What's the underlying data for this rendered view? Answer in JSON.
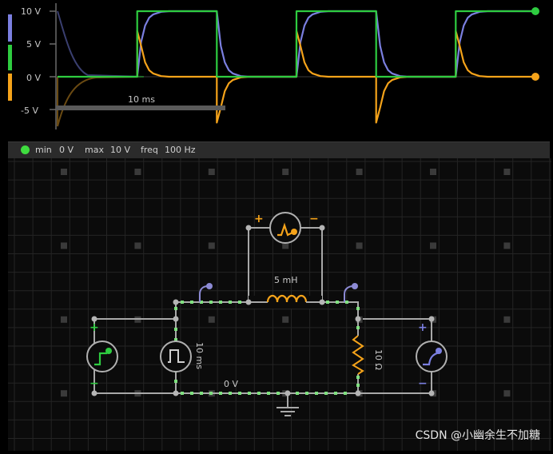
{
  "scope": {
    "y_labels": [
      "10 V",
      "5 V",
      "0 V",
      "-5 V"
    ],
    "time_label": "10 ms",
    "channel_colors": [
      "#7b7fe0",
      "#2ecc40",
      "#f5a31a"
    ],
    "channel_names": [
      "blue-channel",
      "green-channel",
      "orange-channel"
    ]
  },
  "chart_data": {
    "type": "line",
    "ylim": [
      -7.5,
      10
    ],
    "y_ticks": [
      10,
      5,
      0,
      -5
    ],
    "x_range_ms": [
      0,
      60
    ],
    "series": [
      {
        "color": "#2ecc40",
        "x": [
          0,
          10,
          10,
          20,
          20,
          30,
          30,
          40,
          40,
          50,
          50,
          60
        ],
        "y": [
          0,
          0,
          10,
          10,
          0,
          0,
          10,
          10,
          0,
          0,
          10,
          10
        ]
      },
      {
        "color": "#7b7fe0",
        "x": [
          10,
          10.5,
          11,
          11.5,
          12,
          13,
          14,
          15,
          17,
          20,
          20.5,
          21,
          21.5,
          22,
          23,
          24,
          25,
          27,
          30,
          30.5,
          31,
          31.5,
          32,
          33,
          34,
          35,
          37,
          40,
          40.5,
          41,
          41.5,
          42,
          43,
          44,
          45,
          47,
          50,
          50.5,
          51,
          51.5,
          52,
          53,
          54,
          55,
          57,
          60
        ],
        "y": [
          0,
          5.3,
          7.8,
          9.0,
          9.5,
          9.9,
          10,
          10,
          10,
          10,
          4.7,
          2.2,
          1.0,
          0.5,
          0.1,
          0,
          0,
          0,
          0,
          5.3,
          7.8,
          9.0,
          9.5,
          9.9,
          10,
          10,
          10,
          10,
          4.7,
          2.2,
          1.0,
          0.5,
          0.1,
          0,
          0,
          0,
          0,
          5.3,
          7.8,
          9.0,
          9.5,
          9.9,
          10,
          10,
          10,
          10
        ]
      },
      {
        "color": "#f5a31a",
        "x": [
          10,
          10,
          10.5,
          11,
          11.5,
          12,
          13,
          14,
          15,
          20,
          20,
          20.5,
          21,
          21.5,
          22,
          23,
          24,
          25,
          30,
          30,
          30.5,
          31,
          31.5,
          32,
          33,
          34,
          35,
          40,
          40,
          40.5,
          41,
          41.5,
          42,
          43,
          44,
          45,
          50,
          50,
          50.5,
          51,
          51.5,
          52,
          53,
          54,
          55,
          60
        ],
        "y": [
          0,
          7.0,
          4.7,
          2.2,
          1.0,
          0.5,
          0.1,
          0,
          0,
          0,
          -7.0,
          -4.7,
          -2.2,
          -1.0,
          -0.5,
          -0.1,
          0,
          0,
          0,
          7.0,
          4.7,
          2.2,
          1.0,
          0.5,
          0.1,
          0,
          0,
          0,
          -7.0,
          -4.7,
          -2.2,
          -1.0,
          -0.5,
          -0.1,
          0,
          0,
          0,
          7.0,
          4.7,
          2.2,
          1.0,
          0.5,
          0.1,
          0,
          0,
          0
        ]
      }
    ]
  },
  "status": {
    "dot_color": "#3fdc3f",
    "min_label": "min",
    "min_value": "0 V",
    "max_label": "max",
    "max_value": "10 V",
    "freq_label": "freq",
    "freq_value": "100 Hz"
  },
  "circuit": {
    "inductor_label": "5 mH",
    "source_label": "10 ms",
    "resistor_label": "10 Ω",
    "ground_label": "0 V",
    "plus": "+",
    "minus": "−"
  },
  "watermark": "CSDN @小幽余生不加糖"
}
